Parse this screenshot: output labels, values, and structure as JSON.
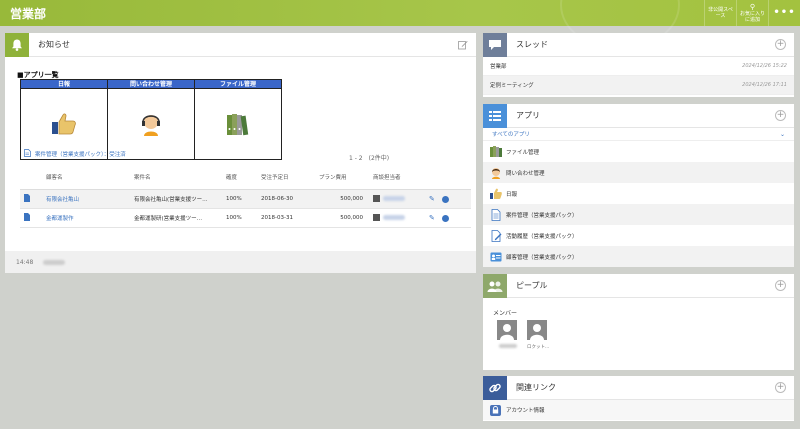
{
  "topbar": {
    "title": "営業部",
    "actions": [
      {
        "label": "非公開スペース",
        "icon": "lock-icon"
      },
      {
        "label": "お気に入りに追加",
        "icon": "pin-icon"
      },
      {
        "label": "•••",
        "icon": "more-icon"
      }
    ]
  },
  "notice": {
    "title": "お知らせ",
    "apps_heading": "■アプリ一覧",
    "app_cards": [
      {
        "label": "日報",
        "icon": "thumbs-up-icon"
      },
      {
        "label": "問い合わせ管理",
        "icon": "headset-person-icon"
      },
      {
        "label": "ファイル管理",
        "icon": "binders-icon"
      }
    ],
    "record_link": "案件管理（営業支援パック）：受注済",
    "record_count": "1 - 2　(2件中)",
    "columns": [
      "顧客名",
      "案件名",
      "確度",
      "受注予定日",
      "プラン費用",
      "商談担当者"
    ],
    "rows": [
      {
        "customer": "有限会社亀山",
        "project": "有限会社亀山(営業支援ツー…",
        "certainty": "100%",
        "date": "2018-06-30",
        "cost": "500,000"
      },
      {
        "customer": "金都運製作",
        "project": "金都運製研(営業支援ツー…",
        "certainty": "100%",
        "date": "2018-03-31",
        "cost": "500,000"
      }
    ],
    "footer_time": "14:48"
  },
  "threads": {
    "title": "スレッド",
    "items": [
      {
        "name": "営業部",
        "timestamp": "2024/12/26 15:22"
      },
      {
        "name": "定例ミーティング",
        "timestamp": "2024/12/26 17:11"
      }
    ]
  },
  "apps": {
    "title": "アプリ",
    "all_label": "すべてのアプリ",
    "items": [
      {
        "label": "ファイル管理",
        "icon": "binders-icon"
      },
      {
        "label": "問い合わせ管理",
        "icon": "headset-person-icon"
      },
      {
        "label": "日報",
        "icon": "thumbs-up-icon"
      },
      {
        "label": "案件管理（営業支援パック）",
        "icon": "document-icon"
      },
      {
        "label": "活動履歴（営業支援パック）",
        "icon": "document-edit-icon"
      },
      {
        "label": "顧客管理（営業支援パック）",
        "icon": "id-card-icon"
      }
    ]
  },
  "people": {
    "title": "ピープル",
    "members_label": "メンバー",
    "members": [
      {
        "name": ""
      },
      {
        "name": "ロクット..."
      }
    ]
  },
  "links": {
    "title": "関連リンク",
    "items": [
      {
        "label": "アカウント情報",
        "icon": "lock-icon"
      }
    ]
  },
  "colors": {
    "topbar": "#a3c23f",
    "accent_blue": "#3a73c0",
    "notice_icon_bg": "#8fb23a",
    "threads_icon_bg": "#6f7f9a",
    "apps_icon_bg": "#4a90d9",
    "people_icon_bg": "#8ea86a",
    "links_icon_bg": "#3b5d9a"
  }
}
